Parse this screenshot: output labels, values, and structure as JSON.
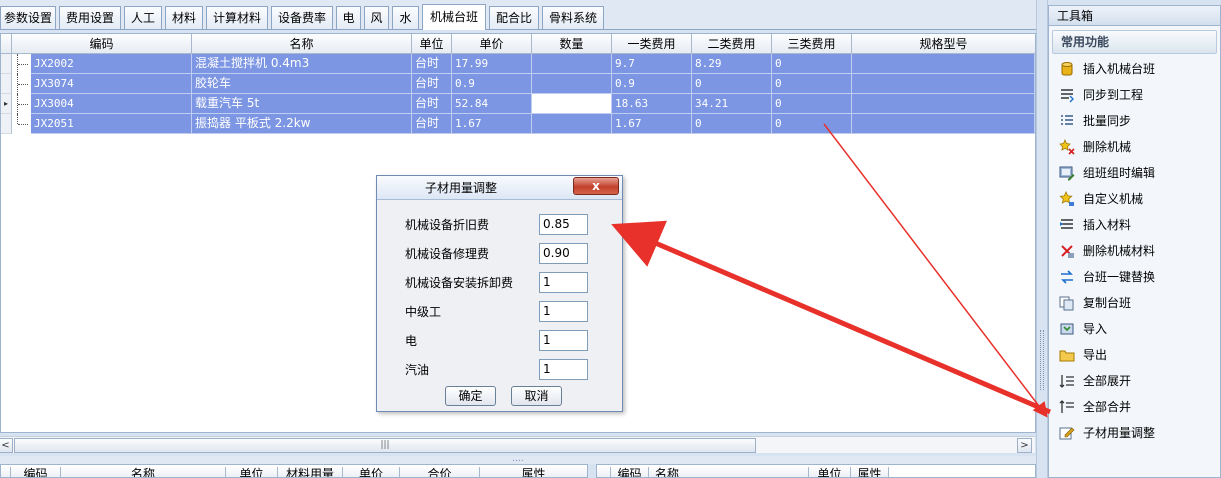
{
  "tabs": [
    {
      "label": "参数设置",
      "active": false
    },
    {
      "label": "费用设置",
      "active": false
    },
    {
      "label": "人工",
      "active": false
    },
    {
      "label": "材料",
      "active": false
    },
    {
      "label": "计算材料",
      "active": false
    },
    {
      "label": "设备费率",
      "active": false
    },
    {
      "label": "电",
      "active": false
    },
    {
      "label": "风",
      "active": false
    },
    {
      "label": "水",
      "active": false
    },
    {
      "label": "机械台班",
      "active": true
    },
    {
      "label": "配合比",
      "active": false
    },
    {
      "label": "骨料系统",
      "active": false
    }
  ],
  "grid": {
    "columns": [
      "编码",
      "名称",
      "单位",
      "单价",
      "数量",
      "一类费用",
      "二类费用",
      "三类费用",
      "规格型号"
    ],
    "rows": [
      {
        "code": "JX2002",
        "name": "混凝土搅拌机 0.4m3",
        "unit": "台时",
        "price": "17.99",
        "qty": "",
        "c1": "9.7",
        "c2": "8.29",
        "c3": "0",
        "spec": ""
      },
      {
        "code": "JX3074",
        "name": "胶轮车",
        "unit": "台时",
        "price": "0.9",
        "qty": "",
        "c1": "0.9",
        "c2": "0",
        "c3": "0",
        "spec": ""
      },
      {
        "code": "JX3004",
        "name": "载重汽车 5t",
        "unit": "台时",
        "price": "52.84",
        "qty": "",
        "c1": "18.63",
        "c2": "34.21",
        "c3": "0",
        "spec": ""
      },
      {
        "code": "JX2051",
        "name": "振捣器 平板式 2.2kw",
        "unit": "台时",
        "price": "1.67",
        "qty": "",
        "c1": "1.67",
        "c2": "0",
        "c3": "0",
        "spec": ""
      }
    ],
    "current_row_marker": "▸"
  },
  "scroll": {
    "left": "<",
    "right": ">",
    "thumb_grip": "|||"
  },
  "splitter_grip": "....",
  "bottom_left": {
    "columns": [
      "编码",
      "名称",
      "单位",
      "材料用量",
      "单价",
      "合价",
      "属性"
    ]
  },
  "bottom_right": {
    "columns": [
      "编码",
      "名称",
      "单位",
      "属性"
    ]
  },
  "dialog": {
    "title": "子材用量调整",
    "close": "x",
    "fields": [
      {
        "label": "机械设备折旧费",
        "value": "0.85"
      },
      {
        "label": "机械设备修理费",
        "value": "0.90"
      },
      {
        "label": "机械设备安装拆卸费",
        "value": "1"
      },
      {
        "label": "中级工",
        "value": "1"
      },
      {
        "label": "电",
        "value": "1"
      },
      {
        "label": "汽油",
        "value": "1"
      }
    ],
    "ok": "确定",
    "cancel": "取消"
  },
  "toolbox": {
    "title": "工具箱",
    "section": "常用功能",
    "items": [
      {
        "label": "插入机械台班",
        "icon": "cylinder-insert-icon"
      },
      {
        "label": "同步到工程",
        "icon": "sync-list-icon"
      },
      {
        "label": "批量同步",
        "icon": "batch-list-icon"
      },
      {
        "label": "删除机械",
        "icon": "delete-star-icon"
      },
      {
        "label": "组班组时编辑",
        "icon": "group-edit-icon"
      },
      {
        "label": "自定义机械",
        "icon": "custom-star-icon"
      },
      {
        "label": "插入材料",
        "icon": "insert-material-icon"
      },
      {
        "label": "删除机械材料",
        "icon": "delete-material-icon"
      },
      {
        "label": "台班一键替换",
        "icon": "swap-arrows-icon"
      },
      {
        "label": "复制台班",
        "icon": "copy-icon"
      },
      {
        "label": "导入",
        "icon": "import-icon"
      },
      {
        "label": "导出",
        "icon": "export-folder-icon"
      },
      {
        "label": "全部展开",
        "icon": "expand-all-icon"
      },
      {
        "label": "全部合并",
        "icon": "collapse-all-icon"
      },
      {
        "label": "子材用量调整",
        "icon": "edit-pencil-icon"
      }
    ]
  },
  "colors": {
    "selection": "#7d96e3",
    "annotation_arrow": "#e8312a"
  }
}
